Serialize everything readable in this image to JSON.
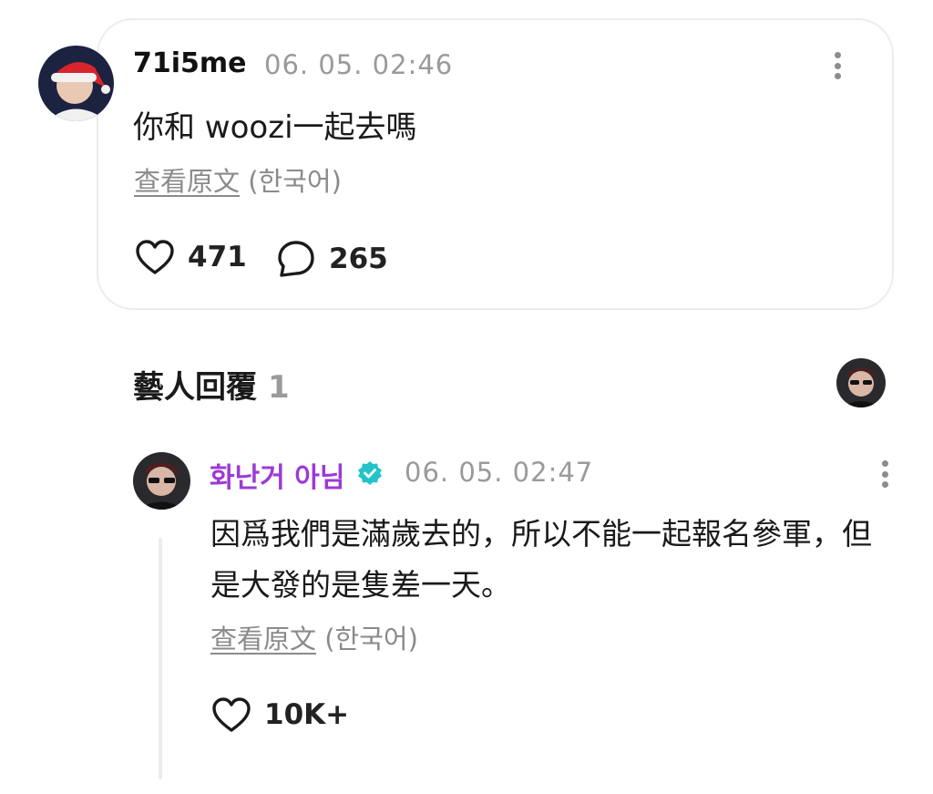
{
  "user_comment": {
    "username": "71i5me",
    "timestamp": "06. 05. 02:46",
    "text": "你和 woozi一起去嗎",
    "translate_link": "查看原文",
    "translate_lang": "(한국어)",
    "likes": "471",
    "replies": "265"
  },
  "artist_section": {
    "title": "藝人回覆",
    "count": "1"
  },
  "artist_reply": {
    "name": "화난거 아님",
    "timestamp": "06. 05. 02:47",
    "text": "因爲我們是滿歲去的，所以不能一起報名參軍，但是大發的是隻差一天。",
    "translate_link": "查看原文",
    "translate_lang": "(한국어)",
    "likes": "10K+"
  },
  "colors": {
    "artist_name": "#9b3ad6",
    "verified_badge": "#22c4c8",
    "muted": "#9a9a9a"
  }
}
